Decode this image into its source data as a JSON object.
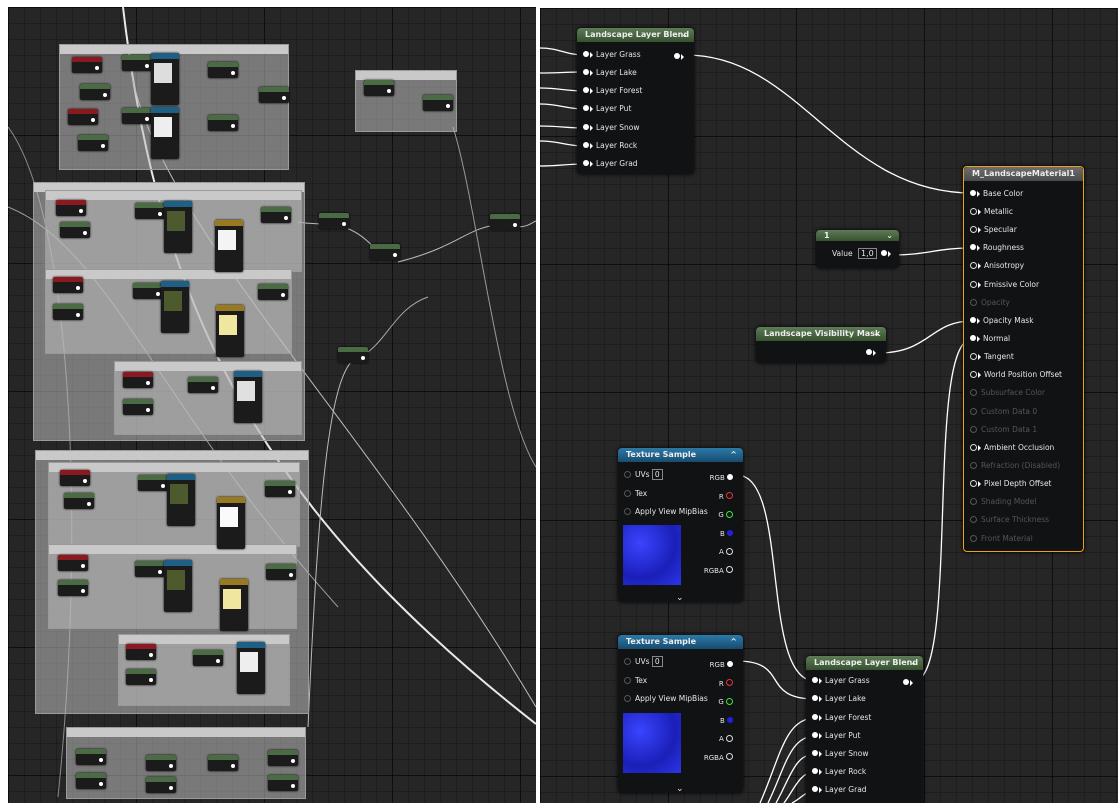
{
  "layer_blend_top": {
    "title": "Landscape Layer Blend",
    "layers": [
      "Layer Grass",
      "Layer Lake",
      "Layer Forest",
      "Layer Put",
      "Layer Snow",
      "Layer Rock",
      "Layer Grad"
    ]
  },
  "layer_blend_bottom": {
    "title": "Landscape Layer Blend",
    "layers": [
      "Layer Grass",
      "Layer Lake",
      "Layer Forest",
      "Layer Put",
      "Layer Snow",
      "Layer Rock",
      "Layer Grad"
    ]
  },
  "material": {
    "title": "M_LandscapeMaterial1",
    "inputs": [
      {
        "label": "Base Color",
        "active": true
      },
      {
        "label": "Metallic",
        "active": true
      },
      {
        "label": "Specular",
        "active": true
      },
      {
        "label": "Roughness",
        "active": true
      },
      {
        "label": "Anisotropy",
        "active": true
      },
      {
        "label": "Emissive Color",
        "active": true
      },
      {
        "label": "Opacity",
        "active": false
      },
      {
        "label": "Opacity Mask",
        "active": true
      },
      {
        "label": "Normal",
        "active": true
      },
      {
        "label": "Tangent",
        "active": true
      },
      {
        "label": "World Position Offset",
        "active": true
      },
      {
        "label": "Subsurface Color",
        "active": false
      },
      {
        "label": "Custom Data 0",
        "active": false
      },
      {
        "label": "Custom Data 1",
        "active": false
      },
      {
        "label": "Ambient Occlusion",
        "active": true
      },
      {
        "label": "Refraction (Disabled)",
        "active": false
      },
      {
        "label": "Pixel Depth Offset",
        "active": true
      },
      {
        "label": "Shading Model",
        "active": false
      },
      {
        "label": "Surface Thickness",
        "active": false
      },
      {
        "label": "Front Material",
        "active": false
      }
    ]
  },
  "constant_node": {
    "title": "1",
    "value_label": "Value",
    "value": "1,0"
  },
  "visibility_mask": {
    "title": "Landscape Visibility Mask"
  },
  "texture_sample_1": {
    "title": "Texture Sample",
    "uvs_label": "UVs",
    "uvs_value": "0",
    "tex_label": "Tex",
    "mip_label": "Apply View MipBias",
    "outputs": [
      "RGB",
      "R",
      "G",
      "B",
      "A",
      "RGBA"
    ]
  },
  "texture_sample_2": {
    "title": "Texture Sample",
    "uvs_label": "UVs",
    "uvs_value": "0",
    "tex_label": "Tex",
    "mip_label": "Apply View MipBias",
    "outputs": [
      "RGB",
      "R",
      "G",
      "B",
      "A",
      "RGBA"
    ]
  },
  "colors": {
    "material_border": "#e8a21c",
    "grid_bg": "#262626"
  }
}
